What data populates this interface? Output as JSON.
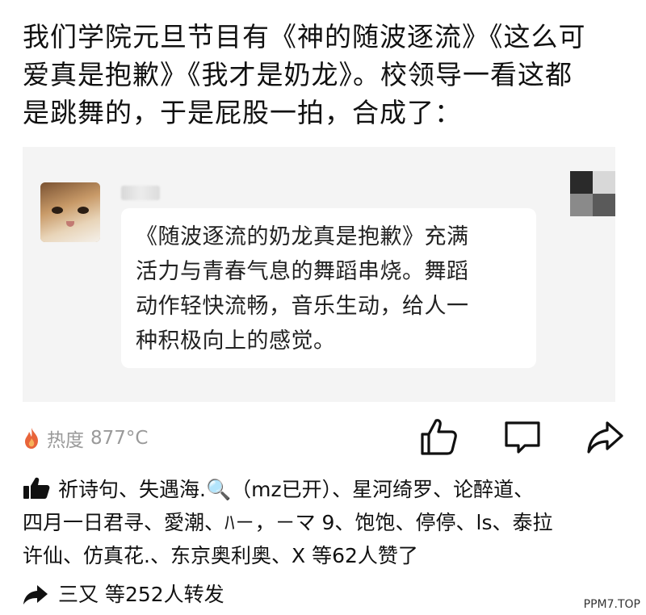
{
  "post": {
    "lines": [
      "我们学院元旦节目有《神的随波逐流》《这么可",
      "爱真是抱歉》《我才是奶龙》。校领导一看这都",
      "是跳舞的，于是屁股一拍，合成了："
    ]
  },
  "quote": {
    "bubble_lines": [
      "《随波逐流的奶龙真是抱歉》充满",
      "活力与青春气息的舞蹈串烧。舞蹈",
      "动作轻快流畅，音乐生动，给人一",
      "种积极向上的感觉。"
    ]
  },
  "stats": {
    "heat_label": "热度",
    "heat_value": "877°C"
  },
  "likes": {
    "line1": [
      "祈诗句",
      "、",
      "失遇海.",
      "🔍",
      "（mz已开）",
      "、",
      "星河绮罗",
      "、",
      "论醉道",
      "、"
    ],
    "line2": [
      "四月一日君寻",
      "、",
      "愛潮",
      "、",
      "ﾊ－，－マ 9",
      "、",
      "饱饱",
      "、",
      "停停",
      "、",
      "ls",
      "、",
      "泰拉"
    ],
    "line3": [
      "许仙",
      "、",
      "仿真花.",
      "、",
      "东京奥利奥",
      "、",
      "X",
      " 等62人赞了"
    ]
  },
  "reposts": {
    "names": "三又",
    "text": " 等252人转发"
  },
  "watermark": "PPM7.TOP",
  "colors": {
    "heat_flame": "#e8643a",
    "card_bg": "#f4f4f4",
    "muted_text": "#9a9a9a"
  },
  "icons": [
    "flame-icon",
    "like-icon",
    "comment-icon",
    "share-icon",
    "thumbs-up-icon",
    "repost-arrow-icon"
  ]
}
